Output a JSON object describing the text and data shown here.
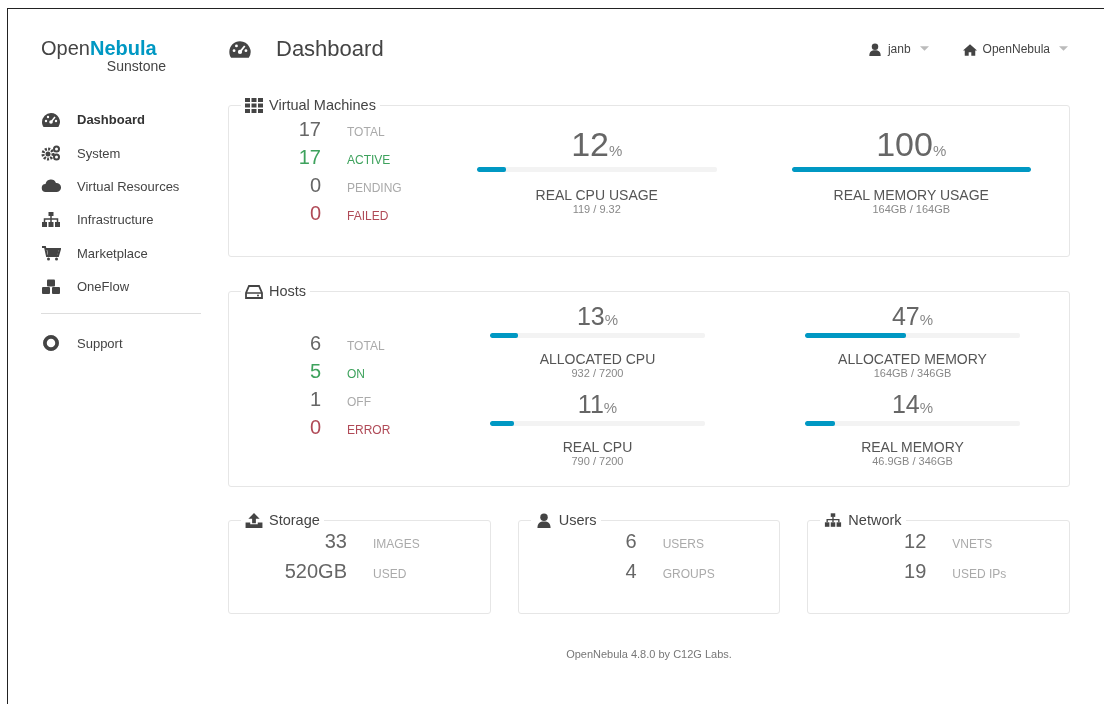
{
  "logo": {
    "first": "Open",
    "second": "Nebula",
    "sub": "Sunstone"
  },
  "header": {
    "title": "Dashboard",
    "user": "janb",
    "zone": "OpenNebula"
  },
  "sidebar": {
    "items": [
      {
        "label": "Dashboard",
        "selected": true
      },
      {
        "label": "System",
        "selected": false
      },
      {
        "label": "Virtual Resources",
        "selected": false
      },
      {
        "label": "Infrastructure",
        "selected": false
      },
      {
        "label": "Marketplace",
        "selected": false
      },
      {
        "label": "OneFlow",
        "selected": false
      }
    ],
    "bottom_items": [
      {
        "label": "Support",
        "selected": false
      }
    ]
  },
  "panels": [
    {
      "title": "Virtual Machines",
      "stats": [
        {
          "value": "17",
          "label": "TOTAL",
          "kind": "neutral"
        },
        {
          "value": "17",
          "label": "ACTIVE",
          "kind": "ok"
        },
        {
          "value": "0",
          "label": "PENDING",
          "kind": "neutral"
        },
        {
          "value": "0",
          "label": "FAILED",
          "kind": "error"
        }
      ],
      "meters": [
        {
          "percent": "12",
          "unit": "%",
          "level": 0.12,
          "label": "REAL CPU USAGE",
          "detail": "119 / 9.32"
        },
        {
          "percent": "100",
          "unit": "%",
          "level": 1.0,
          "label": "REAL MEMORY USAGE",
          "detail": "164GB / 164GB"
        }
      ]
    },
    {
      "title": "Hosts",
      "stats": [
        {
          "value": "6",
          "label": "TOTAL",
          "kind": "neutral"
        },
        {
          "value": "5",
          "label": "ON",
          "kind": "ok"
        },
        {
          "value": "1",
          "label": "OFF",
          "kind": "neutral"
        },
        {
          "value": "0",
          "label": "ERROR",
          "kind": "error"
        }
      ],
      "meters": [
        {
          "percent": "13",
          "unit": "%",
          "level": 0.13,
          "label": "ALLOCATED CPU",
          "detail": "932 / 7200"
        },
        {
          "percent": "47",
          "unit": "%",
          "level": 0.47,
          "label": "ALLOCATED MEMORY",
          "detail": "164GB / 346GB"
        },
        {
          "percent": "11",
          "unit": "%",
          "level": 0.11,
          "label": "REAL CPU",
          "detail": "790 / 7200"
        },
        {
          "percent": "14",
          "unit": "%",
          "level": 0.14,
          "label": "REAL MEMORY",
          "detail": "46.9GB / 346GB"
        }
      ]
    }
  ],
  "small_panels": [
    {
      "title": "Storage",
      "stats": [
        {
          "value": "33",
          "label": "IMAGES"
        },
        {
          "value": "520GB",
          "label": "USED"
        }
      ]
    },
    {
      "title": "Users",
      "stats": [
        {
          "value": "6",
          "label": "USERS"
        },
        {
          "value": "4",
          "label": "GROUPS"
        }
      ]
    },
    {
      "title": "Network",
      "stats": [
        {
          "value": "12",
          "label": "VNETS"
        },
        {
          "value": "19",
          "label": "USED IPs"
        }
      ]
    }
  ],
  "footer": "OpenNebula 4.8.0 by C12G Labs."
}
